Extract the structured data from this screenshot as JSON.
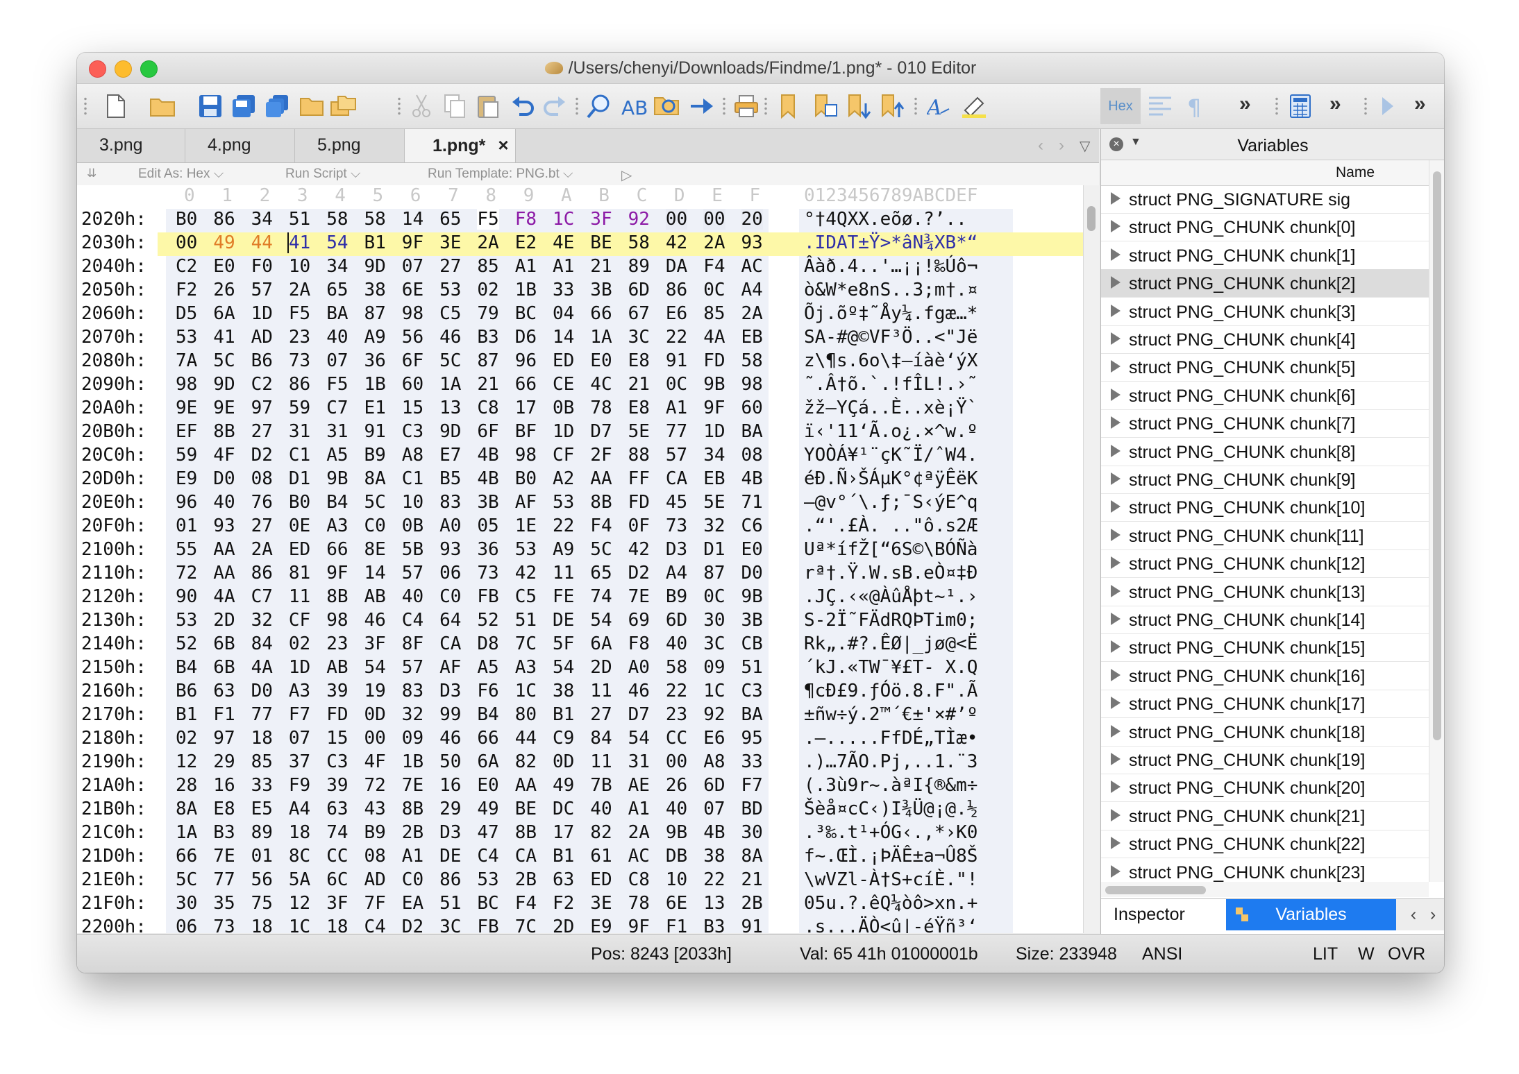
{
  "window": {
    "title": "/Users/chenyi/Downloads/Findme/1.png* - 010 Editor"
  },
  "tabs": [
    {
      "label": "3.png",
      "active": false
    },
    {
      "label": "4.png",
      "active": false
    },
    {
      "label": "5.png",
      "active": false
    },
    {
      "label": "1.png*",
      "active": true
    }
  ],
  "tab_close_glyph": "×",
  "subbar": {
    "edit_as": "Edit As: Hex",
    "run_script": "Run Script",
    "run_template": "Run Template: PNG.bt"
  },
  "toolbar": {
    "hex_label": "Hex"
  },
  "hex": {
    "column_headers": [
      "0",
      "1",
      "2",
      "3",
      "4",
      "5",
      "6",
      "7",
      "8",
      "9",
      "A",
      "B",
      "C",
      "D",
      "E",
      "F"
    ],
    "ascii_header": "0123456789ABCDEF",
    "rows": [
      {
        "addr": "2020h:",
        "bytes": [
          "B0",
          "86",
          "34",
          "51",
          "58",
          "58",
          "14",
          "65",
          "F5",
          "F8",
          "1C",
          "3F",
          "92",
          "00",
          "00",
          "20"
        ],
        "ascii": "°†4QXX.eõø.?’.."
      },
      {
        "addr": "2030h:",
        "bytes": [
          "00",
          "49",
          "44",
          "41",
          "54",
          "B1",
          "9F",
          "3E",
          "2A",
          "E2",
          "4E",
          "BE",
          "58",
          "42",
          "2A",
          "93"
        ],
        "ascii": ".IDAT±Ÿ>*âN¾XB*“"
      },
      {
        "addr": "2040h:",
        "bytes": [
          "C2",
          "E0",
          "F0",
          "10",
          "34",
          "9D",
          "07",
          "27",
          "85",
          "A1",
          "A1",
          "21",
          "89",
          "DA",
          "F4",
          "AC"
        ],
        "ascii": "Âàð.4..'…¡¡!‰Úô¬"
      },
      {
        "addr": "2050h:",
        "bytes": [
          "F2",
          "26",
          "57",
          "2A",
          "65",
          "38",
          "6E",
          "53",
          "02",
          "1B",
          "33",
          "3B",
          "6D",
          "86",
          "0C",
          "A4"
        ],
        "ascii": "ò&W*e8nS..3;m†.¤"
      },
      {
        "addr": "2060h:",
        "bytes": [
          "D5",
          "6A",
          "1D",
          "F5",
          "BA",
          "87",
          "98",
          "C5",
          "79",
          "BC",
          "04",
          "66",
          "67",
          "E6",
          "85",
          "2A"
        ],
        "ascii": "Õj.õº‡˜Åy¼.fgæ…*"
      },
      {
        "addr": "2070h:",
        "bytes": [
          "53",
          "41",
          "AD",
          "23",
          "40",
          "A9",
          "56",
          "46",
          "B3",
          "D6",
          "14",
          "1A",
          "3C",
          "22",
          "4A",
          "EB"
        ],
        "ascii": "SA-#@©VF³Ö..<\"Jë"
      },
      {
        "addr": "2080h:",
        "bytes": [
          "7A",
          "5C",
          "B6",
          "73",
          "07",
          "36",
          "6F",
          "5C",
          "87",
          "96",
          "ED",
          "E0",
          "E8",
          "91",
          "FD",
          "58"
        ],
        "ascii": "z\\¶s.6o\\‡–íàè‘ýX"
      },
      {
        "addr": "2090h:",
        "bytes": [
          "98",
          "9D",
          "C2",
          "86",
          "F5",
          "1B",
          "60",
          "1A",
          "21",
          "66",
          "CE",
          "4C",
          "21",
          "0C",
          "9B",
          "98"
        ],
        "ascii": "˜.Â†õ.`.!fÎL!.›˜"
      },
      {
        "addr": "20A0h:",
        "bytes": [
          "9E",
          "9E",
          "97",
          "59",
          "C7",
          "E1",
          "15",
          "13",
          "C8",
          "17",
          "0B",
          "78",
          "E8",
          "A1",
          "9F",
          "60"
        ],
        "ascii": "žž—YÇá..È..xè¡Ÿ`"
      },
      {
        "addr": "20B0h:",
        "bytes": [
          "EF",
          "8B",
          "27",
          "31",
          "31",
          "91",
          "C3",
          "9D",
          "6F",
          "BF",
          "1D",
          "D7",
          "5E",
          "77",
          "1D",
          "BA"
        ],
        "ascii": "ï‹'11‘Ã.o¿.×^w.º"
      },
      {
        "addr": "20C0h:",
        "bytes": [
          "59",
          "4F",
          "D2",
          "C1",
          "A5",
          "B9",
          "A8",
          "E7",
          "4B",
          "98",
          "CF",
          "2F",
          "88",
          "57",
          "34",
          "08"
        ],
        "ascii": "YOÒÁ¥¹¨çK˜Ï/ˆW4."
      },
      {
        "addr": "20D0h:",
        "bytes": [
          "E9",
          "D0",
          "08",
          "D1",
          "9B",
          "8A",
          "C1",
          "B5",
          "4B",
          "B0",
          "A2",
          "AA",
          "FF",
          "CA",
          "EB",
          "4B"
        ],
        "ascii": "éÐ.Ñ›ŠÁµK°¢ªÿÊëK"
      },
      {
        "addr": "20E0h:",
        "bytes": [
          "96",
          "40",
          "76",
          "B0",
          "B4",
          "5C",
          "10",
          "83",
          "3B",
          "AF",
          "53",
          "8B",
          "FD",
          "45",
          "5E",
          "71"
        ],
        "ascii": "–@v°´\\.ƒ;¯S‹ýE^q"
      },
      {
        "addr": "20F0h:",
        "bytes": [
          "01",
          "93",
          "27",
          "0E",
          "A3",
          "C0",
          "0B",
          "A0",
          "05",
          "1E",
          "22",
          "F4",
          "0F",
          "73",
          "32",
          "C6"
        ],
        "ascii": ".“'.£À. ..\"ô.s2Æ"
      },
      {
        "addr": "2100h:",
        "bytes": [
          "55",
          "AA",
          "2A",
          "ED",
          "66",
          "8E",
          "5B",
          "93",
          "36",
          "53",
          "A9",
          "5C",
          "42",
          "D3",
          "D1",
          "E0"
        ],
        "ascii": "Uª*ífŽ[“6S©\\BÓÑà"
      },
      {
        "addr": "2110h:",
        "bytes": [
          "72",
          "AA",
          "86",
          "81",
          "9F",
          "14",
          "57",
          "06",
          "73",
          "42",
          "11",
          "65",
          "D2",
          "A4",
          "87",
          "D0"
        ],
        "ascii": "rª†.Ÿ.W.sB.eÒ¤‡Ð"
      },
      {
        "addr": "2120h:",
        "bytes": [
          "90",
          "4A",
          "C7",
          "11",
          "8B",
          "AB",
          "40",
          "C0",
          "FB",
          "C5",
          "FE",
          "74",
          "7E",
          "B9",
          "0C",
          "9B"
        ],
        "ascii": ".JÇ.‹«@ÀûÅþt~¹.›"
      },
      {
        "addr": "2130h:",
        "bytes": [
          "53",
          "2D",
          "32",
          "CF",
          "98",
          "46",
          "C4",
          "64",
          "52",
          "51",
          "DE",
          "54",
          "69",
          "6D",
          "30",
          "3B"
        ],
        "ascii": "S-2Ï˜FÄdRQÞTim0;"
      },
      {
        "addr": "2140h:",
        "bytes": [
          "52",
          "6B",
          "84",
          "02",
          "23",
          "3F",
          "8F",
          "CA",
          "D8",
          "7C",
          "5F",
          "6A",
          "F8",
          "40",
          "3C",
          "CB"
        ],
        "ascii": "Rk„.#?.ÊØ|_jø@<Ë"
      },
      {
        "addr": "2150h:",
        "bytes": [
          "B4",
          "6B",
          "4A",
          "1D",
          "AB",
          "54",
          "57",
          "AF",
          "A5",
          "A3",
          "54",
          "2D",
          "A0",
          "58",
          "09",
          "51"
        ],
        "ascii": "´kJ.«TW¯¥£T- X.Q"
      },
      {
        "addr": "2160h:",
        "bytes": [
          "B6",
          "63",
          "D0",
          "A3",
          "39",
          "19",
          "83",
          "D3",
          "F6",
          "1C",
          "38",
          "11",
          "46",
          "22",
          "1C",
          "C3"
        ],
        "ascii": "¶cÐ£9.ƒÓö.8.F\".Ã"
      },
      {
        "addr": "2170h:",
        "bytes": [
          "B1",
          "F1",
          "77",
          "F7",
          "FD",
          "0D",
          "32",
          "99",
          "B4",
          "80",
          "B1",
          "27",
          "D7",
          "23",
          "92",
          "BA"
        ],
        "ascii": "±ñw÷ý.2™´€±'×#’º"
      },
      {
        "addr": "2180h:",
        "bytes": [
          "02",
          "97",
          "18",
          "07",
          "15",
          "00",
          "09",
          "46",
          "66",
          "44",
          "C9",
          "84",
          "54",
          "CC",
          "E6",
          "95"
        ],
        "ascii": ".—.....FfDÉ„TÌæ•"
      },
      {
        "addr": "2190h:",
        "bytes": [
          "12",
          "29",
          "85",
          "37",
          "C3",
          "4F",
          "1B",
          "50",
          "6A",
          "82",
          "0D",
          "11",
          "31",
          "00",
          "A8",
          "33"
        ],
        "ascii": ".)…7ÃO.Pj‚..1.¨3"
      },
      {
        "addr": "21A0h:",
        "bytes": [
          "28",
          "16",
          "33",
          "F9",
          "39",
          "72",
          "7E",
          "16",
          "E0",
          "AA",
          "49",
          "7B",
          "AE",
          "26",
          "6D",
          "F7"
        ],
        "ascii": "(.3ù9r~.àªI{®&m÷"
      },
      {
        "addr": "21B0h:",
        "bytes": [
          "8A",
          "E8",
          "E5",
          "A4",
          "63",
          "43",
          "8B",
          "29",
          "49",
          "BE",
          "DC",
          "40",
          "A1",
          "40",
          "07",
          "BD"
        ],
        "ascii": "Šèå¤cC‹)I¾Ü@¡@.½"
      },
      {
        "addr": "21C0h:",
        "bytes": [
          "1A",
          "B3",
          "89",
          "18",
          "74",
          "B9",
          "2B",
          "D3",
          "47",
          "8B",
          "17",
          "82",
          "2A",
          "9B",
          "4B",
          "30"
        ],
        "ascii": ".³‰.t¹+ÓG‹.‚*›K0"
      },
      {
        "addr": "21D0h:",
        "bytes": [
          "66",
          "7E",
          "01",
          "8C",
          "CC",
          "08",
          "A1",
          "DE",
          "C4",
          "CA",
          "B1",
          "61",
          "AC",
          "DB",
          "38",
          "8A"
        ],
        "ascii": "f~.ŒÌ.¡ÞÄÊ±a¬Û8Š"
      },
      {
        "addr": "21E0h:",
        "bytes": [
          "5C",
          "77",
          "56",
          "5A",
          "6C",
          "AD",
          "C0",
          "86",
          "53",
          "2B",
          "63",
          "ED",
          "C8",
          "10",
          "22",
          "21"
        ],
        "ascii": "\\wVZl-À†S+cíÈ.\"!"
      },
      {
        "addr": "21F0h:",
        "bytes": [
          "30",
          "35",
          "75",
          "12",
          "3F",
          "7F",
          "EA",
          "51",
          "BC",
          "F4",
          "F2",
          "3E",
          "78",
          "6E",
          "13",
          "2B"
        ],
        "ascii": "05u.?.êQ¼òô>xn.+"
      },
      {
        "addr": "2200h:",
        "bytes": [
          "06",
          "73",
          "18",
          "1C",
          "18",
          "C4",
          "D2",
          "3C",
          "FB",
          "7C",
          "2D",
          "E9",
          "9F",
          "F1",
          "B3",
          "91"
        ],
        "ascii": ".s...ÄÒ<û|-éŸñ³‘"
      }
    ]
  },
  "panel": {
    "title": "Variables",
    "column_name": "Name",
    "items": [
      "struct PNG_SIGNATURE sig",
      "struct PNG_CHUNK chunk[0]",
      "struct PNG_CHUNK chunk[1]",
      "struct PNG_CHUNK chunk[2]",
      "struct PNG_CHUNK chunk[3]",
      "struct PNG_CHUNK chunk[4]",
      "struct PNG_CHUNK chunk[5]",
      "struct PNG_CHUNK chunk[6]",
      "struct PNG_CHUNK chunk[7]",
      "struct PNG_CHUNK chunk[8]",
      "struct PNG_CHUNK chunk[9]",
      "struct PNG_CHUNK chunk[10]",
      "struct PNG_CHUNK chunk[11]",
      "struct PNG_CHUNK chunk[12]",
      "struct PNG_CHUNK chunk[13]",
      "struct PNG_CHUNK chunk[14]",
      "struct PNG_CHUNK chunk[15]",
      "struct PNG_CHUNK chunk[16]",
      "struct PNG_CHUNK chunk[17]",
      "struct PNG_CHUNK chunk[18]",
      "struct PNG_CHUNK chunk[19]",
      "struct PNG_CHUNK chunk[20]",
      "struct PNG_CHUNK chunk[21]",
      "struct PNG_CHUNK chunk[22]",
      "struct PNG_CHUNK chunk[23]"
    ],
    "selected_index": 3,
    "tab_inspector": "Inspector",
    "tab_variables": "Variables"
  },
  "status": {
    "pos": "Pos: 8243 [2033h]",
    "val": "Val: 65 41h 01000001b",
    "size": "Size: 233948",
    "encoding": "ANSI",
    "lit": "LIT",
    "w": "W",
    "ovr": "OVR"
  },
  "colors": {
    "accent_blue": "#1e7bf0",
    "chunk_len_orange": "#e07b26",
    "chunk_type_blue": "#2e2ea8",
    "prev_chunk_purple": "#8c1aa6",
    "row_highlight": "#fdf8a8"
  }
}
